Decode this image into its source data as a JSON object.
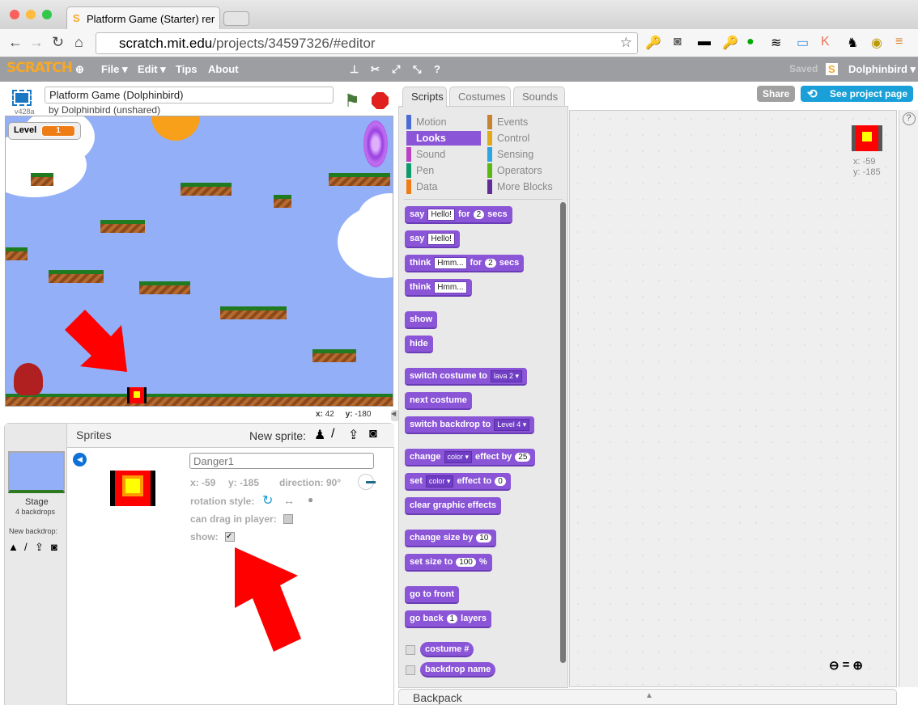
{
  "browser": {
    "tab_title": "Platform Game (Starter) rer",
    "url_host": "scratch.mit.edu",
    "url_path": "/projects/34597326/#editor"
  },
  "menu": {
    "logo": "SCRATCH",
    "file": "File ▾",
    "edit": "Edit ▾",
    "tips": "Tips",
    "about": "About",
    "saved": "Saved",
    "user": "Dolphinbird ▾"
  },
  "stage_header": {
    "version": "v428a",
    "title": "Platform Game (Dolphinbird)",
    "byline": "by Dolphinbird (unshared)"
  },
  "stage": {
    "monitor_label": "Level",
    "monitor_value": "1",
    "mouse_x_label": "x:",
    "mouse_x": "42",
    "mouse_y_label": "y:",
    "mouse_y": "-180"
  },
  "sprites_pane": {
    "title": "Sprites",
    "new_sprite": "New sprite:",
    "stage_label": "Stage",
    "stage_backdrops": "4 backdrops",
    "new_backdrop": "New backdrop:"
  },
  "sprite_info": {
    "name": "Danger1",
    "x": "x: -59",
    "y": "y: -185",
    "direction": "direction: 90°",
    "rotation_style": "rotation style:",
    "can_drag": "can drag in player:",
    "can_drag_checked": false,
    "show": "show:",
    "show_checked": true
  },
  "tabs": [
    "Scripts",
    "Costumes",
    "Sounds"
  ],
  "header_buttons": {
    "share": "Share",
    "see_project": "See project page"
  },
  "categories": [
    {
      "label": "Motion",
      "color": "#4a6cd4"
    },
    {
      "label": "Events",
      "color": "#c88330"
    },
    {
      "label": "Looks",
      "color": "#8a55d7",
      "selected": true
    },
    {
      "label": "Control",
      "color": "#e1a91a"
    },
    {
      "label": "Sound",
      "color": "#bb42c3"
    },
    {
      "label": "Sensing",
      "color": "#2ca5e2"
    },
    {
      "label": "Pen",
      "color": "#0e9a6c"
    },
    {
      "label": "Operators",
      "color": "#5cb712"
    },
    {
      "label": "Data",
      "color": "#ee7d16"
    },
    {
      "label": "More Blocks",
      "color": "#632d99"
    }
  ],
  "blocks": [
    {
      "parts": [
        [
          "t",
          "say"
        ],
        [
          "i",
          "Hello!"
        ],
        [
          "t",
          "for"
        ],
        [
          "n",
          "2"
        ],
        [
          "t",
          "secs"
        ]
      ]
    },
    {
      "parts": [
        [
          "t",
          "say"
        ],
        [
          "i",
          "Hello!"
        ]
      ]
    },
    {
      "parts": [
        [
          "t",
          "think"
        ],
        [
          "i",
          "Hmm..."
        ],
        [
          "t",
          "for"
        ],
        [
          "n",
          "2"
        ],
        [
          "t",
          "secs"
        ]
      ]
    },
    {
      "parts": [
        [
          "t",
          "think"
        ],
        [
          "i",
          "Hmm..."
        ]
      ]
    },
    {
      "parts": [
        [
          "t",
          "show"
        ]
      ]
    },
    {
      "parts": [
        [
          "t",
          "hide"
        ]
      ]
    },
    {
      "parts": [
        [
          "t",
          "switch costume to"
        ],
        [
          "d",
          "lava 2 ▾"
        ]
      ]
    },
    {
      "parts": [
        [
          "t",
          "next costume"
        ]
      ]
    },
    {
      "parts": [
        [
          "t",
          "switch backdrop to"
        ],
        [
          "d",
          "Level 4 ▾"
        ]
      ]
    },
    {
      "parts": [
        [
          "t",
          "change"
        ],
        [
          "d",
          "color ▾"
        ],
        [
          "t",
          "effect by"
        ],
        [
          "n",
          "25"
        ]
      ]
    },
    {
      "parts": [
        [
          "t",
          "set"
        ],
        [
          "d",
          "color ▾"
        ],
        [
          "t",
          "effect to"
        ],
        [
          "n",
          "0"
        ]
      ]
    },
    {
      "parts": [
        [
          "t",
          "clear graphic effects"
        ]
      ]
    },
    {
      "parts": [
        [
          "t",
          "change size by"
        ],
        [
          "n",
          "10"
        ]
      ]
    },
    {
      "parts": [
        [
          "t",
          "set size to"
        ],
        [
          "n",
          "100"
        ],
        [
          "t",
          "%"
        ]
      ]
    },
    {
      "parts": [
        [
          "t",
          "go to front"
        ]
      ]
    },
    {
      "parts": [
        [
          "t",
          "go back"
        ],
        [
          "n",
          "1"
        ],
        [
          "t",
          "layers"
        ]
      ]
    },
    {
      "reporter": true,
      "parts": [
        [
          "t",
          "costume #"
        ]
      ]
    },
    {
      "reporter": true,
      "parts": [
        [
          "t",
          "backdrop name"
        ]
      ]
    }
  ],
  "script_area": {
    "sprite_x": "x: -59",
    "sprite_y": "y: -185"
  },
  "backpack": "Backpack",
  "colors": {
    "looks": "#8a55d7",
    "menubar": "#9c9ea2",
    "accent": "#1aa0d8"
  }
}
